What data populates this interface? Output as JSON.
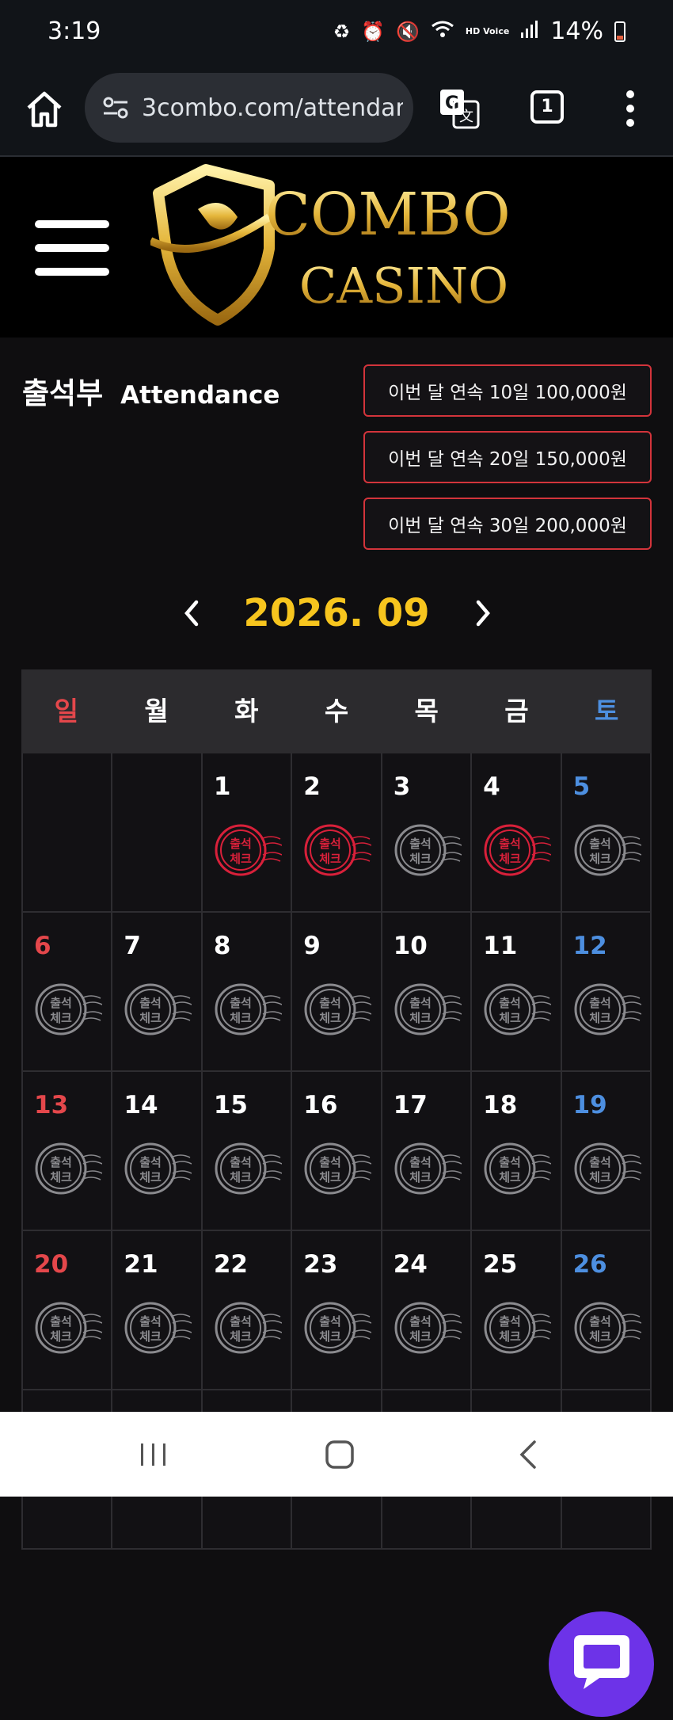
{
  "status_bar": {
    "time": "3:19",
    "hd_voice": "HD Voice",
    "battery": "14%",
    "icons": [
      "recycle-icon",
      "alarm-icon",
      "mute-icon",
      "wifi-icon",
      "hd-voice-icon",
      "signal-icon",
      "battery-icon"
    ]
  },
  "browser": {
    "url": "3combo.com/attendan",
    "tab_count": "1"
  },
  "site": {
    "logo_text_top": "COMBO",
    "logo_text_bottom": "CASINO"
  },
  "page": {
    "title_ko": "출석부",
    "title_en": "Attendance",
    "bonuses": [
      "이번 달 연속 10일 100,000원",
      "이번 달 연속 20일 150,000원",
      "이번 달 연속 30일 200,000원"
    ],
    "month_label": "2026. 09"
  },
  "calendar": {
    "weekdays": [
      "일",
      "월",
      "화",
      "수",
      "목",
      "금",
      "토"
    ],
    "stamp_text_top": "출석",
    "stamp_text_bottom": "체크",
    "days": [
      {
        "d": "",
        "checked": false
      },
      {
        "d": "",
        "checked": false
      },
      {
        "d": "1",
        "checked": true
      },
      {
        "d": "2",
        "checked": true
      },
      {
        "d": "3",
        "checked": false
      },
      {
        "d": "4",
        "checked": true
      },
      {
        "d": "5",
        "checked": false
      },
      {
        "d": "6",
        "checked": false
      },
      {
        "d": "7",
        "checked": false
      },
      {
        "d": "8",
        "checked": false
      },
      {
        "d": "9",
        "checked": false
      },
      {
        "d": "10",
        "checked": false
      },
      {
        "d": "11",
        "checked": false
      },
      {
        "d": "12",
        "checked": false
      },
      {
        "d": "13",
        "checked": false
      },
      {
        "d": "14",
        "checked": false
      },
      {
        "d": "15",
        "checked": false
      },
      {
        "d": "16",
        "checked": false
      },
      {
        "d": "17",
        "checked": false
      },
      {
        "d": "18",
        "checked": false
      },
      {
        "d": "19",
        "checked": false
      },
      {
        "d": "20",
        "checked": false
      },
      {
        "d": "21",
        "checked": false
      },
      {
        "d": "22",
        "checked": false
      },
      {
        "d": "23",
        "checked": false
      },
      {
        "d": "24",
        "checked": false
      },
      {
        "d": "25",
        "checked": false
      },
      {
        "d": "26",
        "checked": false
      }
    ]
  },
  "colors": {
    "accent_gold": "#f7c51e",
    "bonus_border": "#d3343b",
    "sunday": "#e4474b",
    "saturday": "#4d8fe0",
    "checked_stamp": "#d8203a",
    "unchecked_stamp": "#8a8a8e",
    "chat_button": "#6d33e8"
  }
}
